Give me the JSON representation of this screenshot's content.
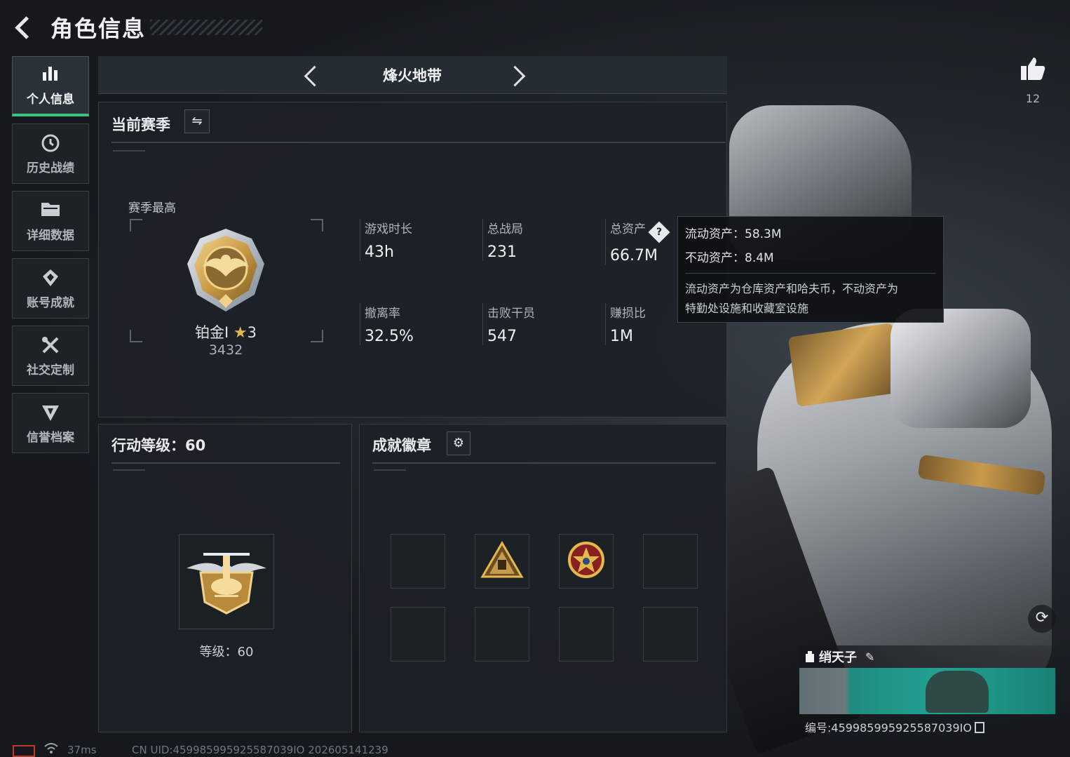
{
  "header": {
    "title": "角色信息"
  },
  "sidebar": {
    "items": [
      {
        "label": "个人信息",
        "icon": "bar-chart-icon",
        "active": true
      },
      {
        "label": "历史战绩",
        "icon": "history-icon"
      },
      {
        "label": "详细数据",
        "icon": "folder-icon"
      },
      {
        "label": "账号成就",
        "icon": "achievement-icon"
      },
      {
        "label": "社交定制",
        "icon": "tools-icon"
      },
      {
        "label": "信誉档案",
        "icon": "shield-icon"
      }
    ]
  },
  "mode": {
    "title": "烽火地带"
  },
  "season": {
    "title": "当前赛季",
    "rank_label": "赛季最高",
    "rank_name": "铂金Ⅰ",
    "rank_stars": "3",
    "rank_score": "3432",
    "stats": [
      {
        "label": "游戏时长",
        "value": "43h"
      },
      {
        "label": "总战局",
        "value": "231"
      },
      {
        "label": "总资产",
        "value": "66.7M"
      },
      {
        "label": "撤离率",
        "value": "32.5%"
      },
      {
        "label": "击败干员",
        "value": "547"
      },
      {
        "label": "赚损比",
        "value": "1M"
      }
    ]
  },
  "tooltip": {
    "liquid": "流动资产：58.3M",
    "fixed": "不动资产：8.4M",
    "note_1": "流动资产为仓库资产和哈夫币，不动资产为",
    "note_2": "特勤处设施和收藏室设施"
  },
  "level": {
    "title": "行动等级：60",
    "label": "等级：60"
  },
  "badges": {
    "title": "成就徽章"
  },
  "social": {
    "likes": "12"
  },
  "player": {
    "name": "绡天子",
    "card_id": "编号:459985995925587039IO"
  },
  "footer": {
    "ping": "37ms",
    "uid": "CN UID:459985995925587039IO 202605141239"
  },
  "colors": {
    "accent_green": "#38c47a",
    "gold": "#e3b94d"
  }
}
